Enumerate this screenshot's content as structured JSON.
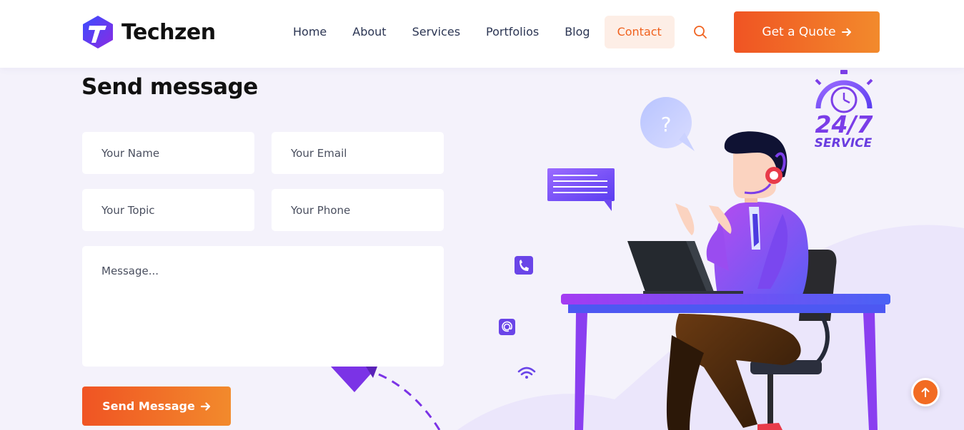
{
  "brand": {
    "name": "Techzen",
    "accent": "#f05423",
    "accent_end": "#f28a2c",
    "logo_color": "#4b3bff"
  },
  "nav": {
    "items": [
      "Home",
      "About",
      "Services",
      "Portfolios",
      "Blog",
      "Contact"
    ],
    "active": "Contact",
    "search_icon": "search-icon"
  },
  "header": {
    "quote_button": "Get a Quote",
    "quote_icon": "arrow-right-icon"
  },
  "form": {
    "title": "Send message",
    "name_placeholder": "Your Name",
    "email_placeholder": "Your Email",
    "topic_placeholder": "Your Topic",
    "phone_placeholder": "Your Phone",
    "message_placeholder": "Message...",
    "submit_label": "Send Message",
    "submit_icon": "arrow-right-icon"
  },
  "illustration": {
    "badge_number": "24/7",
    "badge_text": "SERVICE",
    "bubble_question": "?",
    "icons": [
      "phone-icon",
      "at-icon",
      "wifi-icon",
      "stopwatch-icon"
    ]
  },
  "scroll_top_icon": "arrow-up-icon"
}
